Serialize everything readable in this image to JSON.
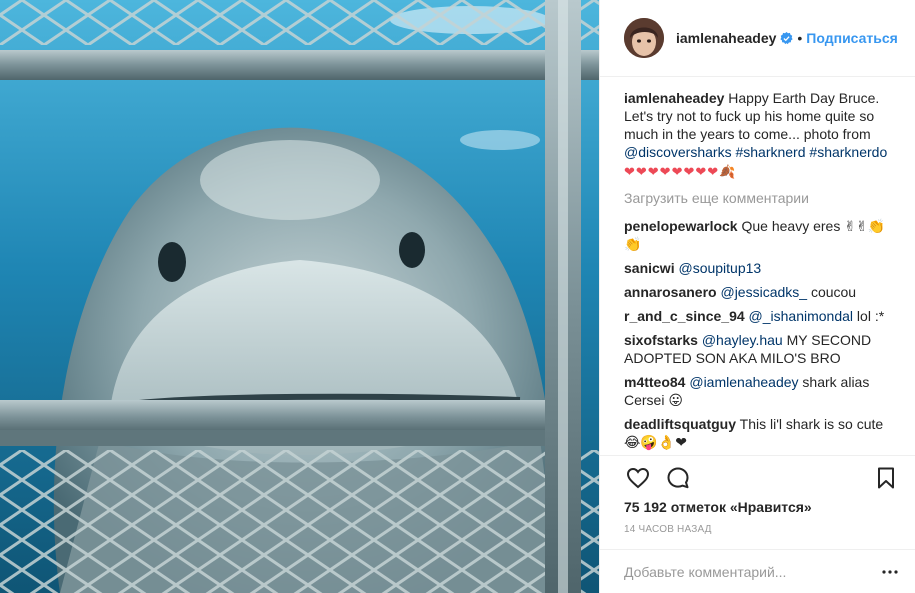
{
  "post": {
    "author": "iamlenaheadey",
    "follow_label": "Подписаться",
    "dot": "•",
    "colors": {
      "accent": "#3897f0",
      "link": "#003569",
      "muted": "#999999",
      "heart": "#ed4956"
    },
    "caption": {
      "user": "iamlenaheadey",
      "text": "Happy Earth Day Bruce. Let's try not to fuck up his home quite so much in the years to come... photo from",
      "mention": "@discoversharks",
      "tag1": "#sharknerd",
      "tag2": "#sharknerdo",
      "emojis": "❤❤❤❤❤❤❤❤🍂"
    },
    "load_more": "Загрузить еще комментарии",
    "comments": [
      {
        "user": "penelopewarlock",
        "text": "Que heavy eres ✌✌👏",
        "extra": "👏"
      },
      {
        "user": "sanicwi",
        "mention": "@soupitup13",
        "text": ""
      },
      {
        "user": "annarosanero",
        "mention": "@jessicadks_",
        "text": "coucou"
      },
      {
        "user": "r_and_c_since_94",
        "mention": "@_ishanimondal",
        "text": "lol :*"
      },
      {
        "user": "sixofstarks",
        "mention": "@hayley.hau",
        "text": "MY SECOND ADOPTED SON AKA MILO'S BRO"
      },
      {
        "user": "m4tteo84",
        "mention": "@iamlenaheadey",
        "text": "shark alias Cersei 😛"
      },
      {
        "user": "deadliftsquatguy",
        "text": "This li'l shark is so cute",
        "extra": "😂🤪👌❤"
      }
    ],
    "likes": "75 192 отметок «Нравится»",
    "time": "14 часов назад",
    "add_comment_placeholder": "Добавьте комментарий...",
    "icons": [
      "heart-icon",
      "comment-icon",
      "bookmark-icon",
      "verified-icon",
      "more-icon"
    ]
  }
}
